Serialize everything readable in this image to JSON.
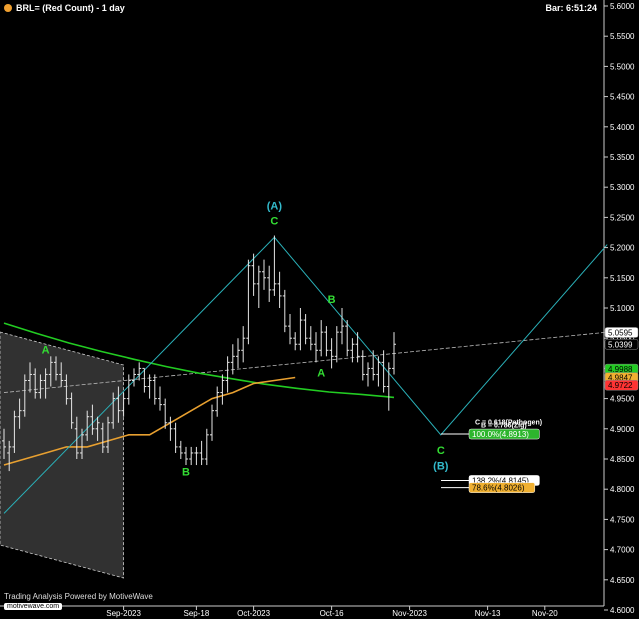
{
  "header": {
    "symbol_title": "BRL= (Red Count) - 1 day",
    "bar_time": "Bar: 6:51:24",
    "status_dot_color": "#f0a030"
  },
  "footer": {
    "credit": "Trading Analysis Powered by MotiveWave",
    "site": "motivewave.com"
  },
  "chart_data": {
    "type": "ohlc",
    "bar_color": "#e6e6e6",
    "background": "#000000",
    "grid": false,
    "yaxis": {
      "position": "right",
      "min": 4.6,
      "max": 5.6,
      "ticks": [
        "4.6000",
        "4.6500",
        "4.7000",
        "4.7500",
        "4.8000",
        "4.8500",
        "4.9000",
        "4.9500",
        "5.0000",
        "5.0500",
        "5.1000",
        "5.1500",
        "5.2000",
        "5.2500",
        "5.3000",
        "5.3500",
        "5.4000",
        "5.4500",
        "5.5000",
        "5.5500",
        "5.6000"
      ]
    },
    "xaxis": {
      "ticks": [
        {
          "label": "Sep-2023",
          "bar": 23
        },
        {
          "label": "Sep-18",
          "bar": 37
        },
        {
          "label": "Oct-2023",
          "bar": 48
        },
        {
          "label": "Oct-16",
          "bar": 63
        },
        {
          "label": "Nov-2023",
          "bar": 78
        },
        {
          "label": "Nov-13",
          "bar": 93
        },
        {
          "label": "Nov-20",
          "bar": 104
        }
      ]
    },
    "ohlc": [
      [
        4.88,
        4.9,
        4.85,
        4.87
      ],
      [
        4.86,
        4.88,
        4.83,
        4.87
      ],
      [
        4.87,
        4.93,
        4.86,
        4.92
      ],
      [
        4.92,
        4.95,
        4.9,
        4.93
      ],
      [
        4.93,
        4.99,
        4.92,
        4.98
      ],
      [
        4.98,
        5.01,
        4.96,
        4.99
      ],
      [
        4.99,
        5.0,
        4.95,
        4.96
      ],
      [
        4.96,
        4.99,
        4.95,
        4.98
      ],
      [
        4.98,
        5.0,
        4.95,
        4.99
      ],
      [
        4.99,
        5.02,
        4.97,
        5.01
      ],
      [
        5.01,
        5.02,
        4.98,
        4.99
      ],
      [
        4.99,
        5.01,
        4.97,
        4.98
      ],
      [
        4.98,
        4.99,
        4.94,
        4.95
      ],
      [
        4.95,
        4.96,
        4.9,
        4.91
      ],
      [
        4.9,
        4.92,
        4.85,
        4.86
      ],
      [
        4.86,
        4.9,
        4.85,
        4.89
      ],
      [
        4.89,
        4.93,
        4.88,
        4.92
      ],
      [
        4.92,
        4.94,
        4.89,
        4.9
      ],
      [
        4.9,
        4.92,
        4.88,
        4.91
      ],
      [
        4.9,
        4.91,
        4.86,
        4.87
      ],
      [
        4.87,
        4.92,
        4.86,
        4.91
      ],
      [
        4.91,
        4.96,
        4.9,
        4.95
      ],
      [
        4.95,
        4.97,
        4.91,
        4.93
      ],
      [
        4.93,
        4.96,
        4.92,
        4.95
      ],
      [
        4.95,
        4.99,
        4.94,
        4.98
      ],
      [
        4.98,
        5.0,
        4.97,
        4.99
      ],
      [
        4.99,
        5.01,
        4.98,
        5.0
      ],
      [
        5.0,
        5.0,
        4.96,
        4.97
      ],
      [
        4.97,
        4.99,
        4.95,
        4.98
      ],
      [
        4.98,
        4.99,
        4.94,
        4.95
      ],
      [
        4.95,
        4.97,
        4.93,
        4.94
      ],
      [
        4.94,
        4.95,
        4.9,
        4.91
      ],
      [
        4.91,
        4.92,
        4.88,
        4.9
      ],
      [
        4.9,
        4.91,
        4.86,
        4.87
      ],
      [
        4.87,
        4.88,
        4.85,
        4.86
      ],
      [
        4.86,
        4.87,
        4.84,
        4.85
      ],
      [
        4.85,
        4.87,
        4.84,
        4.86
      ],
      [
        4.86,
        4.87,
        4.84,
        4.86
      ],
      [
        4.86,
        4.88,
        4.84,
        4.85
      ],
      [
        4.85,
        4.9,
        4.84,
        4.89
      ],
      [
        4.89,
        4.94,
        4.88,
        4.93
      ],
      [
        4.93,
        4.97,
        4.92,
        4.96
      ],
      [
        4.96,
        4.99,
        4.94,
        4.98
      ],
      [
        4.98,
        5.02,
        4.96,
        5.01
      ],
      [
        5.01,
        5.04,
        4.99,
        5.02
      ],
      [
        5.02,
        5.05,
        5.0,
        5.03
      ],
      [
        5.03,
        5.07,
        5.01,
        5.05
      ],
      [
        5.05,
        5.18,
        5.04,
        5.17
      ],
      [
        5.17,
        5.19,
        5.12,
        5.14
      ],
      [
        5.14,
        5.17,
        5.1,
        5.16
      ],
      [
        5.16,
        5.18,
        5.13,
        5.15
      ],
      [
        5.15,
        5.17,
        5.11,
        5.13
      ],
      [
        5.13,
        5.22,
        5.12,
        5.14
      ],
      [
        5.14,
        5.16,
        5.1,
        5.12
      ],
      [
        5.12,
        5.13,
        5.06,
        5.07
      ],
      [
        5.07,
        5.09,
        5.04,
        5.05
      ],
      [
        5.05,
        5.06,
        5.03,
        5.04
      ],
      [
        5.04,
        5.1,
        5.03,
        5.08
      ],
      [
        5.08,
        5.09,
        5.04,
        5.05
      ],
      [
        5.05,
        5.07,
        5.03,
        5.04
      ],
      [
        5.04,
        5.06,
        5.01,
        5.03
      ],
      [
        5.03,
        5.08,
        5.02,
        5.06
      ],
      [
        5.06,
        5.07,
        5.02,
        5.03
      ],
      [
        5.03,
        5.05,
        5.0,
        5.02
      ],
      [
        5.02,
        5.07,
        5.01,
        5.06
      ],
      [
        5.06,
        5.1,
        5.04,
        5.07
      ],
      [
        5.07,
        5.08,
        5.02,
        5.03
      ],
      [
        5.03,
        5.05,
        5.01,
        5.04
      ],
      [
        5.04,
        5.06,
        5.01,
        5.02
      ],
      [
        5.02,
        5.03,
        4.98,
        4.99
      ],
      [
        4.99,
        5.01,
        4.97,
        5.0
      ],
      [
        5.0,
        5.03,
        4.98,
        4.99
      ],
      [
        4.99,
        5.02,
        4.97,
        5.01
      ],
      [
        5.01,
        5.03,
        4.96,
        4.97
      ],
      [
        4.97,
        5.01,
        4.93,
        5.0
      ],
      [
        5.0,
        5.06,
        4.99,
        5.04
      ]
    ],
    "moving_averages": [
      {
        "color": "#22cc22",
        "values": [
          5.075,
          5.058,
          5.042,
          5.028,
          5.015,
          5.003,
          4.992,
          4.983,
          4.974,
          4.967,
          4.961,
          4.957,
          4.952
        ]
      },
      {
        "color": "#e8a030",
        "values": [
          4.84,
          4.85,
          4.86,
          4.87,
          4.87,
          4.88,
          4.89,
          4.89,
          4.91,
          4.93,
          4.95,
          4.96,
          4.975,
          4.98,
          4.985
        ]
      }
    ],
    "wave_labels": [
      {
        "text": "A",
        "color": "#33dd33",
        "bar": 8,
        "price": 5.025
      },
      {
        "text": "B",
        "color": "#33dd33",
        "bar": 35,
        "price": 4.823
      },
      {
        "text": "(A)",
        "color": "#33bbcc",
        "bar": 52,
        "price": 5.263
      },
      {
        "text": "C",
        "color": "#33dd33",
        "bar": 52,
        "price": 5.238
      },
      {
        "text": "B",
        "color": "#33dd33",
        "bar": 63,
        "price": 5.108
      },
      {
        "text": "A",
        "color": "#33dd33",
        "bar": 61,
        "price": 4.987
      },
      {
        "text": "C",
        "color": "#33dd33",
        "bar": 84,
        "price": 4.858
      },
      {
        "text": "(B)",
        "color": "#33bbcc",
        "bar": 84,
        "price": 4.833
      }
    ],
    "zigzag": {
      "color": "#2ab0b8",
      "points": [
        [
          0,
          4.76
        ],
        [
          52,
          5.217
        ],
        [
          84,
          4.89
        ],
        [
          116,
          5.205
        ]
      ]
    },
    "trendline": {
      "color": "#bbbbbb",
      "points": [
        [
          0,
          4.96
        ],
        [
          116,
          5.06
        ]
      ]
    },
    "fib_labels": [
      {
        "text": "C = 0.618(Pathogen)",
        "price": 4.902,
        "color": "#ffffff",
        "bg": "none"
      },
      {
        "text": "B = 0.786(Zig)",
        "price": 4.897,
        "color": "#ffffff",
        "bg": "none"
      },
      {
        "text": "100.0%(4.8913)",
        "price": 4.8913,
        "color": "#ffffff",
        "bg": "#2db52d"
      },
      {
        "text": "138.2%(4.8145)",
        "price": 4.8145,
        "color": "#000000",
        "bg": "#ffffff"
      },
      {
        "text": "78.6%(4.8026)",
        "price": 4.8026,
        "color": "#000000",
        "bg": "#f0b030"
      }
    ],
    "price_tags": [
      {
        "text": "5.0595",
        "price": 5.0595,
        "bg": "#ffffff",
        "color": "#000000"
      },
      {
        "text": "5.0399",
        "price": 5.0399,
        "bg": "#000000",
        "color": "#ffffff"
      },
      {
        "text": "4.9988",
        "price": 4.9988,
        "bg": "#22cc22",
        "color": "#000000"
      },
      {
        "text": "4.9847",
        "price": 4.9847,
        "bg": "#f0b030",
        "color": "#000000"
      },
      {
        "text": "4.9722",
        "price": 4.9722,
        "bg": "#ff3333",
        "color": "#000000"
      }
    ]
  }
}
